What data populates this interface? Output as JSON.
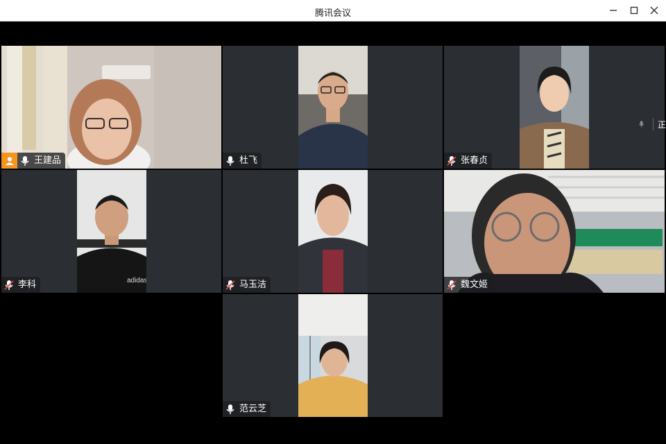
{
  "window": {
    "title": "腾讯会议"
  },
  "colors": {
    "host_badge": "#f7931e",
    "mic_muted_red": "#e0453b",
    "tile_bg": "#2b2f33"
  },
  "participants": [
    {
      "name": "王建品",
      "host": true,
      "mic": "on"
    },
    {
      "name": "杜飞",
      "host": false,
      "mic": "on"
    },
    {
      "name": "张春贞",
      "host": false,
      "mic": "muted"
    },
    {
      "name": "李科",
      "host": false,
      "mic": "muted"
    },
    {
      "name": "马玉洁",
      "host": false,
      "mic": "muted"
    },
    {
      "name": "魏文姬",
      "host": false,
      "mic": "muted"
    },
    {
      "name": "范云芝",
      "host": false,
      "mic": "on"
    }
  ],
  "side_strip": {
    "text": "正"
  }
}
